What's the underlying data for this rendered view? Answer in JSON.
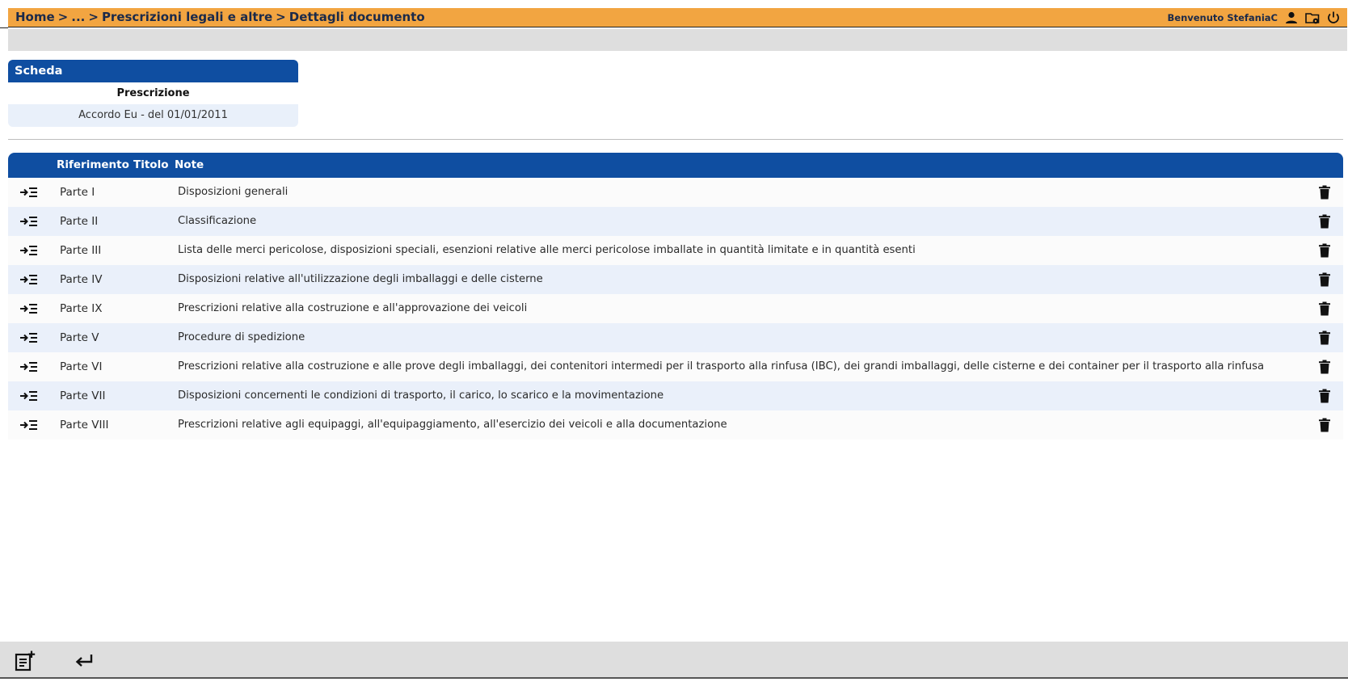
{
  "header": {
    "breadcrumb": [
      {
        "label": "Home"
      },
      {
        "label": "..."
      },
      {
        "label": "Prescrizioni legali e altre"
      },
      {
        "label": "Dettagli documento"
      }
    ],
    "separator": ">",
    "welcome": "Benvenuto StefaniaC",
    "icons": [
      "user-icon",
      "folder-settings-icon",
      "power-icon"
    ],
    "bg_color": "#f2a541"
  },
  "card": {
    "title": "Scheda",
    "label": "Prescrizione",
    "value": "Accordo Eu - del 01/01/2011"
  },
  "table": {
    "columns": {
      "riferimento": "Riferimento",
      "titolo": "Titolo",
      "note": "Note"
    },
    "rows": [
      {
        "riferimento": "Parte I",
        "note": "Disposizioni generali"
      },
      {
        "riferimento": "Parte II",
        "note": "Classificazione"
      },
      {
        "riferimento": "Parte III",
        "note": "Lista delle merci pericolose, disposizioni speciali, esenzioni relative alle merci pericolose imballate in quantità limitate e in quantità esenti"
      },
      {
        "riferimento": "Parte IV",
        "note": "Disposizioni relative all'utilizzazione degli imballaggi e delle cisterne"
      },
      {
        "riferimento": "Parte IX",
        "note": "Prescrizioni relative alla costruzione e all'approvazione dei veicoli"
      },
      {
        "riferimento": "Parte V",
        "note": "Procedure di spedizione"
      },
      {
        "riferimento": "Parte VI",
        "note": "Prescrizioni relative alla costruzione e alle prove degli imballaggi, dei contenitori intermedi per il trasporto alla rinfusa (IBC), dei grandi imballaggi, delle cisterne e dei container per il trasporto alla rinfusa"
      },
      {
        "riferimento": "Parte VII",
        "note": "Disposizioni concernenti le condizioni di trasporto, il carico, lo scarico e la movimentazione"
      },
      {
        "riferimento": "Parte VIII",
        "note": "Prescrizioni relative agli equipaggi, all'equipaggiamento, all'esercizio dei veicoli e alla documentazione"
      }
    ],
    "row_icons": {
      "expand": "expand-list-icon",
      "delete": "trash-icon"
    },
    "header_color": "#0f4ea1",
    "stripe_color": "#eaf0fa"
  },
  "footer": {
    "icons": [
      "add-document-icon",
      "return-arrow-icon"
    ]
  }
}
